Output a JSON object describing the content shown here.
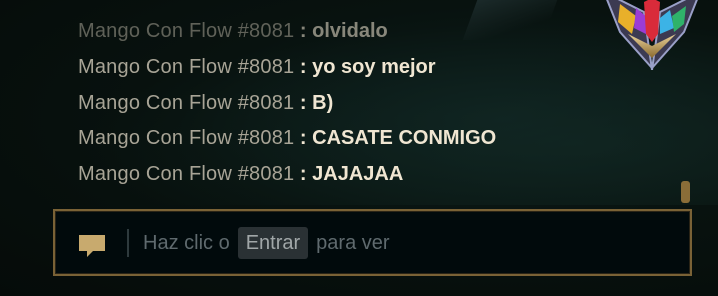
{
  "chat": {
    "messages": [
      {
        "sender": "Mango Con Flow #8081",
        "separator": ":",
        "text": "olvidalo"
      },
      {
        "sender": "Mango Con Flow #8081",
        "separator": ":",
        "text": "yo soy mejor"
      },
      {
        "sender": "Mango Con Flow #8081",
        "separator": ":",
        "text": "B)"
      },
      {
        "sender": "Mango Con Flow #8081",
        "separator": ":",
        "text": "CASATE CONMIGO"
      },
      {
        "sender": "Mango Con Flow #8081",
        "separator": ":",
        "text": "JAJAJAA"
      }
    ]
  },
  "input": {
    "hint_before": "Haz clic o",
    "hint_key": "Entrar",
    "hint_after": "para ver"
  },
  "icons": {
    "chat": "chat-bubble-icon",
    "emblem": "rank-emblem-icon"
  },
  "colors": {
    "sender": "#a8a496",
    "message": "#f0e6d2",
    "gold_border": "#7a6236",
    "scroll_thumb": "#8a6d38"
  }
}
